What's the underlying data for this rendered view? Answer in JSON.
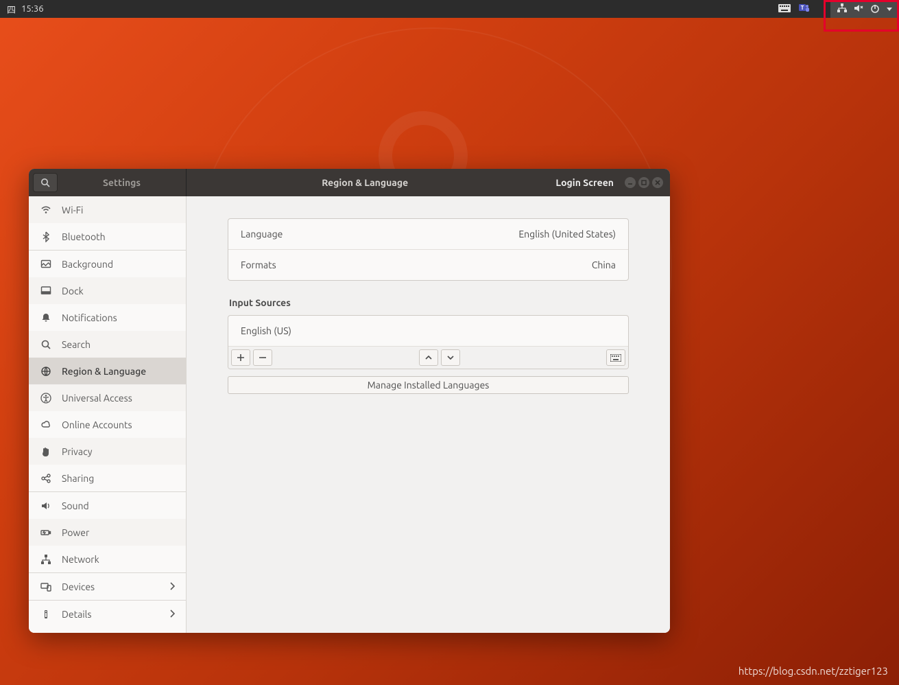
{
  "menubar": {
    "day": "四",
    "time": "15:36"
  },
  "window": {
    "sidebar_title": "Settings",
    "page_title": "Region & Language",
    "login_screen_label": "Login Screen"
  },
  "sidebar": {
    "items": [
      {
        "id": "wifi",
        "label": "Wi-Fi"
      },
      {
        "id": "bluetooth",
        "label": "Bluetooth"
      },
      {
        "id": "background",
        "label": "Background"
      },
      {
        "id": "dock",
        "label": "Dock"
      },
      {
        "id": "notifications",
        "label": "Notifications"
      },
      {
        "id": "search",
        "label": "Search"
      },
      {
        "id": "region",
        "label": "Region & Language"
      },
      {
        "id": "universal",
        "label": "Universal Access"
      },
      {
        "id": "online",
        "label": "Online Accounts"
      },
      {
        "id": "privacy",
        "label": "Privacy"
      },
      {
        "id": "sharing",
        "label": "Sharing"
      },
      {
        "id": "sound",
        "label": "Sound"
      },
      {
        "id": "power",
        "label": "Power"
      },
      {
        "id": "network",
        "label": "Network"
      },
      {
        "id": "devices",
        "label": "Devices"
      },
      {
        "id": "details",
        "label": "Details"
      }
    ]
  },
  "region": {
    "language_label": "Language",
    "language_value": "English (United States)",
    "formats_label": "Formats",
    "formats_value": "China",
    "input_sources_title": "Input Sources",
    "input_sources": [
      "English (US)"
    ],
    "manage_label": "Manage Installed Languages"
  },
  "watermark": "https://blog.csdn.net/zztiger123"
}
